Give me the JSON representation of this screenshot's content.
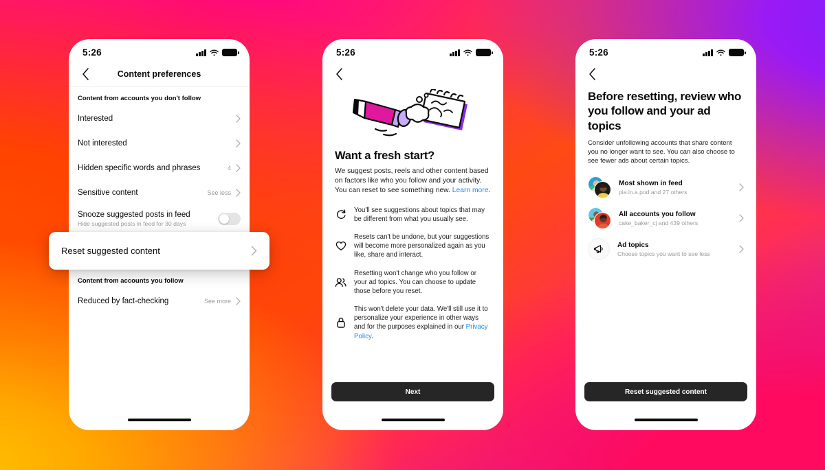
{
  "background": {
    "gradient_colors": [
      "#FF0B86",
      "#FF2C5A",
      "#FF5000",
      "#FFC400",
      "#FF0A5E",
      "#7B1FFF"
    ]
  },
  "accent": {
    "link": "#1a8cff",
    "button": "#262626",
    "chevron": "#b0b0b0"
  },
  "phone1": {
    "status": {
      "time": "5:26",
      "signal_icon": "signal-bars-icon",
      "wifi_icon": "wifi-icon",
      "battery_icon": "battery-icon"
    },
    "nav": {
      "back_icon": "back-chevron-icon",
      "title": "Content preferences"
    },
    "section1_header": "Content from accounts you don't follow",
    "rows": [
      {
        "label": "Interested",
        "meta": "",
        "chevron": true
      },
      {
        "label": "Not interested",
        "meta": "",
        "chevron": true
      },
      {
        "label": "Hidden specific words and phrases",
        "meta": "4",
        "chevron": true
      },
      {
        "label": "Sensitive content",
        "meta": "See less",
        "chevron": true
      }
    ],
    "snooze": {
      "label": "Snooze suggested posts in feed",
      "sub": "Hide suggested posts in feed for 30 days",
      "toggle_state": "off"
    },
    "highlight": {
      "label": "Reset suggested content",
      "chevron_icon": "chevron-right-icon"
    },
    "section2_header": "Content from accounts you follow",
    "rows2": [
      {
        "label": "Reduced by fact-checking",
        "meta": "See more",
        "chevron": true
      }
    ]
  },
  "phone2": {
    "status": {
      "time": "5:26"
    },
    "nav": {
      "back_icon": "back-chevron-icon"
    },
    "illustration_name": "pencil-erasing-notebook-illustration",
    "heading": "Want a fresh start?",
    "body_text": "We suggest posts, reels and other content based on factors like who you follow and your activity. You can reset to see something new. ",
    "body_link": "Learn more",
    "body_link_after": ".",
    "bullets": [
      {
        "icon": "refresh-icon",
        "text": "You'll see suggestions about topics that may be different from what you usually see."
      },
      {
        "icon": "heart-icon",
        "text": "Resets can't be undone, but your suggestions will become more personalized again as you like, share and interact."
      },
      {
        "icon": "people-icon",
        "text": "Resetting won't change who you follow or your ad topics. You can choose to update those before you reset."
      },
      {
        "icon": "lock-icon",
        "text": "This won't delete your data. We'll still use it to personalize your experience in other ways and for the purposes explained in our ",
        "link": "Privacy Policy",
        "after": "."
      }
    ],
    "button_label": "Next"
  },
  "phone3": {
    "status": {
      "time": "5:26"
    },
    "nav": {
      "back_icon": "back-chevron-icon"
    },
    "heading": "Before resetting, review who you follow and your ad topics",
    "subtext": "Consider unfollowing accounts that share content you no longer want to see. You can also choose to see fewer ads about certain topics.",
    "items": [
      {
        "icon": "avatar-stack",
        "title": "Most shown in feed",
        "sub": "pia.in.a.pod and 27 others"
      },
      {
        "icon": "avatar-stack",
        "title": "All accounts you follow",
        "sub": "cake_baker_cj and 439 others"
      },
      {
        "icon": "megaphone-icon",
        "title": "Ad topics",
        "sub": "Choose topics you want to see less"
      }
    ],
    "button_label": "Reset suggested content"
  }
}
